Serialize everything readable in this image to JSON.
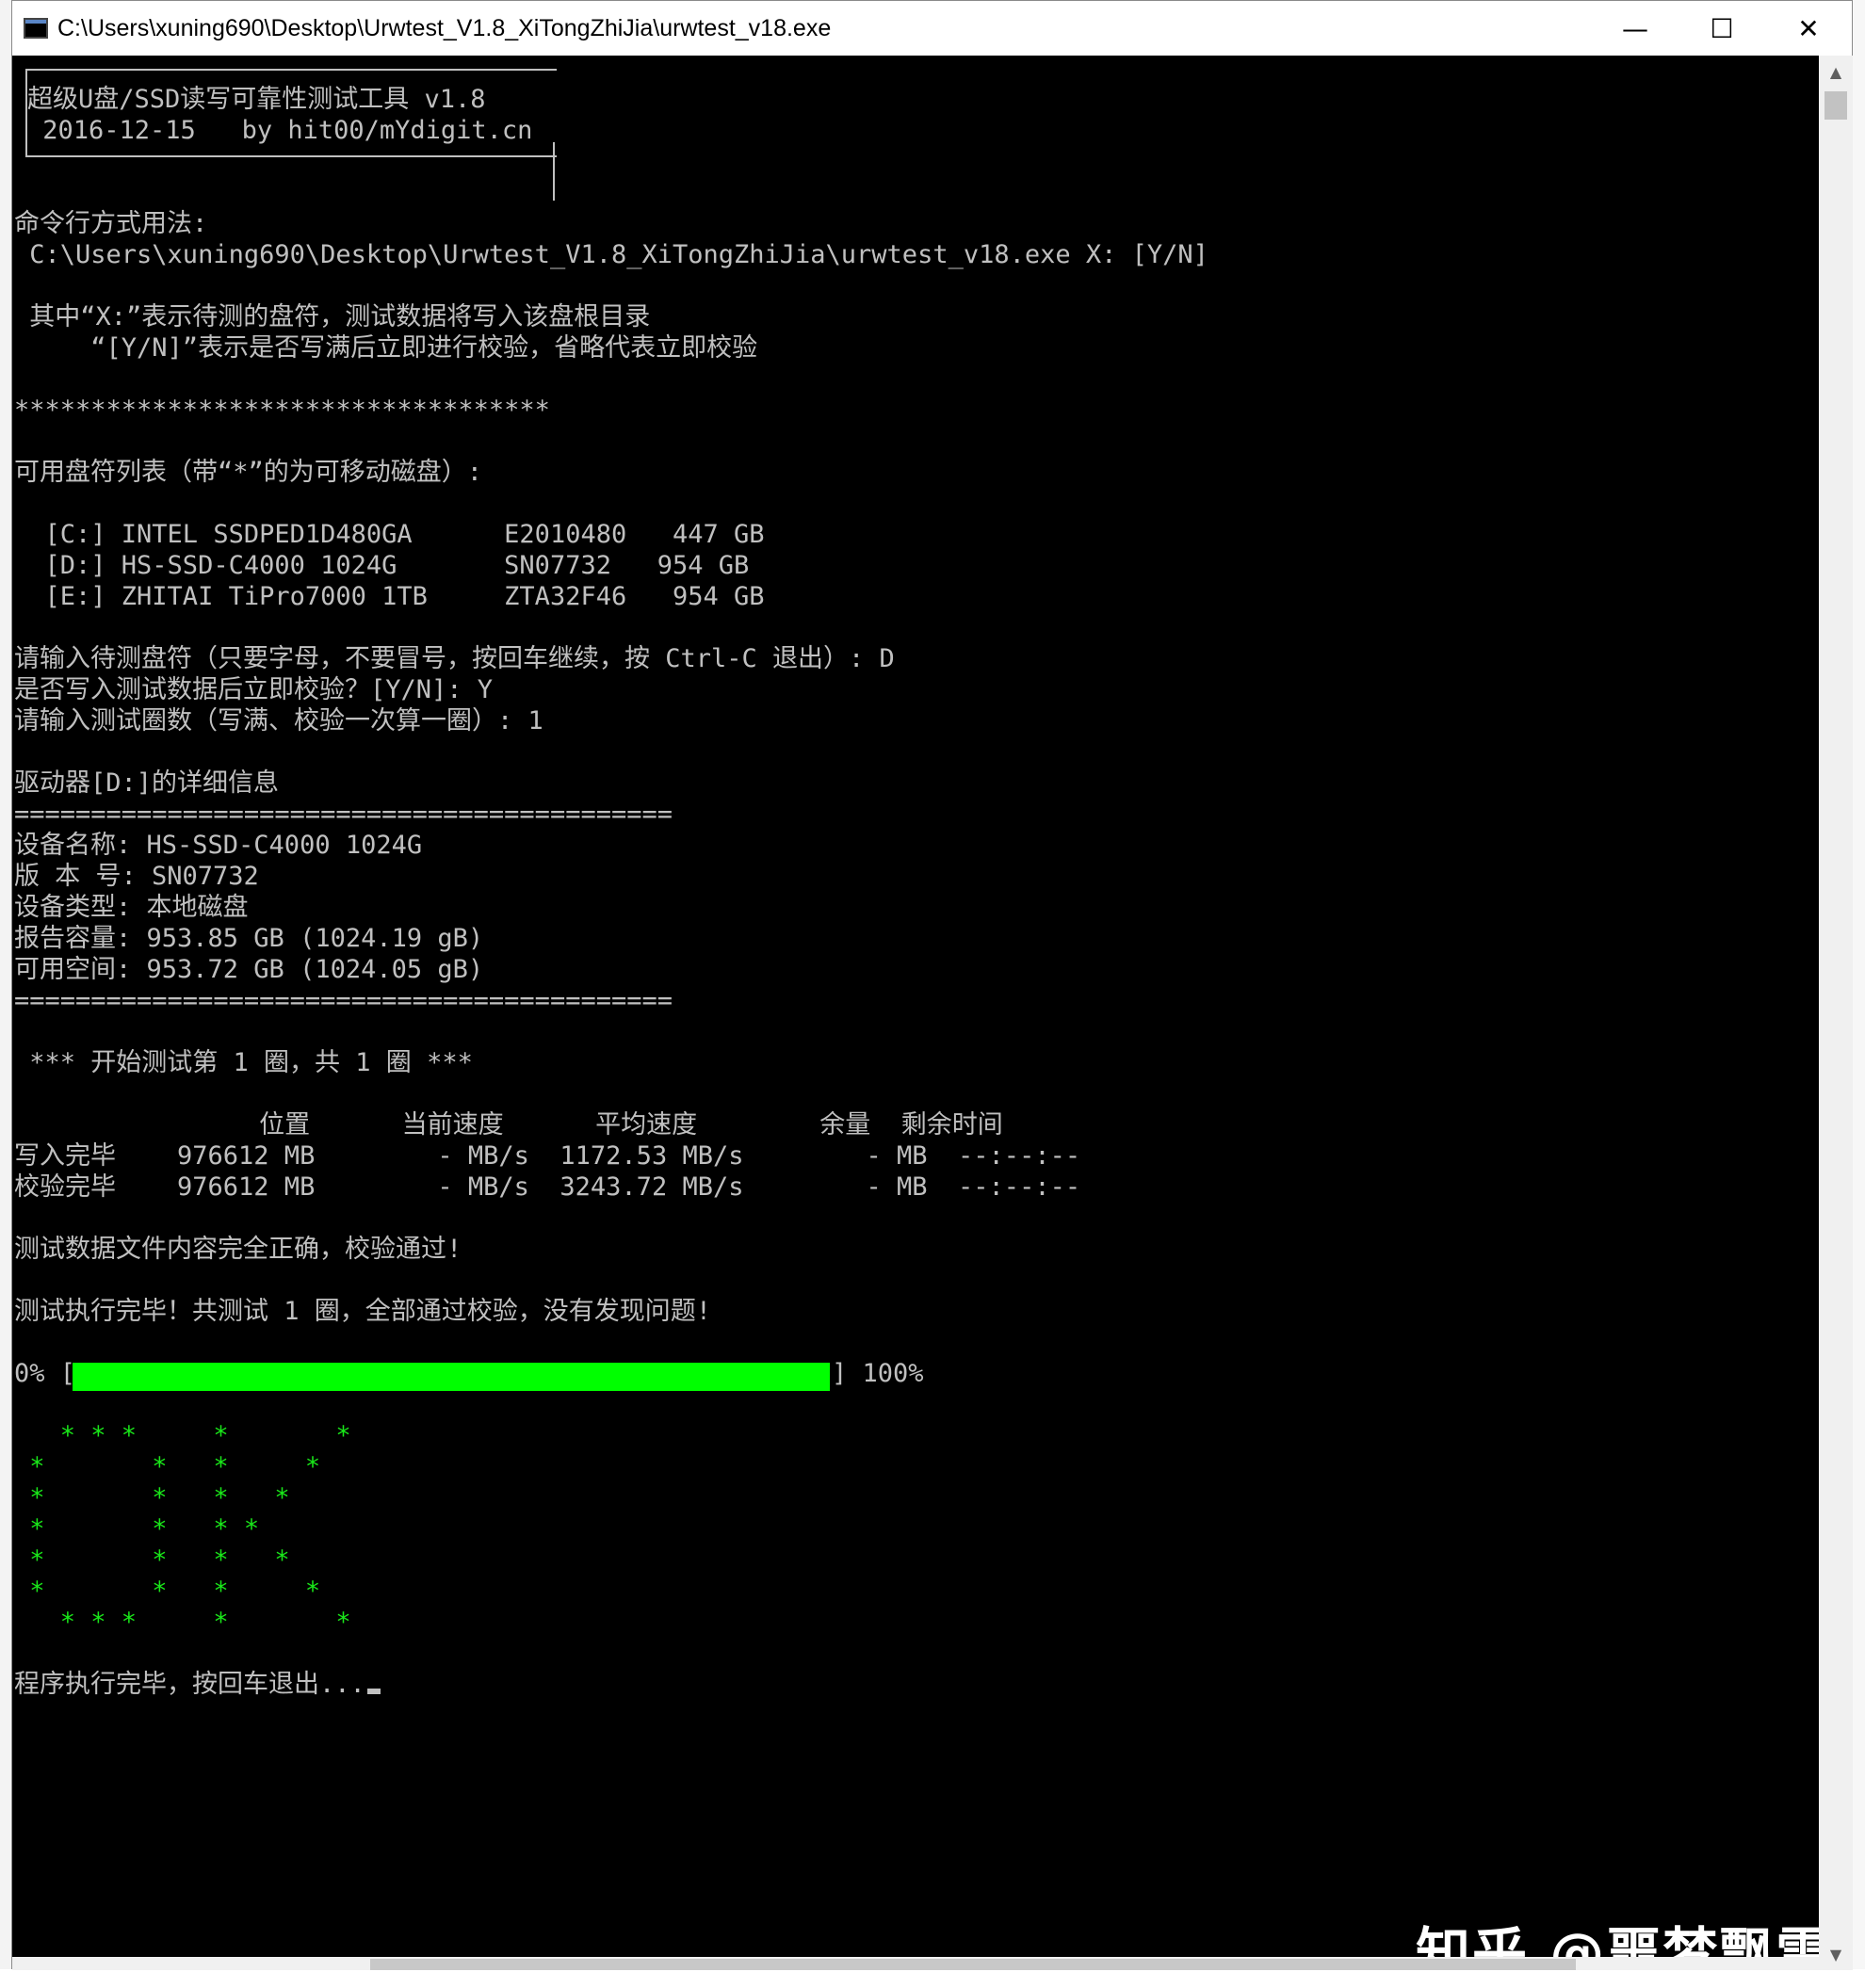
{
  "window": {
    "title": "C:\\Users\\xuning690\\Desktop\\Urwtest_V1.8_XiTongZhiJia\\urwtest_v18.exe",
    "minimize": "—",
    "maximize": "☐",
    "close": "✕"
  },
  "console": {
    "header_line1": "超级U盘/SSD读写可靠性测试工具 v1.8",
    "header_line2": " 2016-12-15   by hit00/mYdigit.cn",
    "usage_title": "命令行方式用法:",
    "usage_cmd": " C:\\Users\\xuning690\\Desktop\\Urwtest_V1.8_XiTongZhiJia\\urwtest_v18.exe X: [Y/N]",
    "usage_desc1": " 其中“X:”表示待测的盘符，测试数据将写入该盘根目录",
    "usage_desc2": "     “[Y/N]”表示是否写满后立即进行校验，省略代表立即校验",
    "separator_stars": "***********************************",
    "drive_list_title": "可用盘符列表（带“*”的为可移动磁盘）:",
    "drives": [
      "  [C:] INTEL SSDPED1D480GA      E2010480   447 GB",
      "  [D:] HS-SSD-C4000 1024G       SN07732   954 GB",
      "  [E:] ZHITAI TiPro7000 1TB     ZTA32F46   954 GB"
    ],
    "prompt_drive": "请输入待测盘符（只要字母，不要冒号，按回车继续，按 Ctrl-C 退出）: D",
    "prompt_verify": "是否写入测试数据后立即校验？[Y/N]: Y",
    "prompt_rounds": "请输入测试圈数（写满、校验一次算一圈）: 1",
    "detail_title": "驱动器[D:]的详细信息",
    "separator_eq": "===========================================",
    "device_name": "设备名称: HS-SSD-C4000 1024G",
    "version": "版 本 号: SN07732",
    "device_type": "设备类型: 本地磁盘",
    "reported_capacity": "报告容量: 953.85 GB (1024.19 gB)",
    "free_space": "可用空间: 953.72 GB (1024.05 gB)",
    "separator_eq2": "===========================================",
    "round_start": " *** 开始测试第 1 圈，共 1 圈 ***",
    "table_header": "                位置      当前速度      平均速度        余量  剩余时间",
    "write_row": "写入完毕    976612 MB        - MB/s  1172.53 MB/s        - MB  --:--:--",
    "verify_row": "校验完毕    976612 MB        - MB/s  3243.72 MB/s        - MB  --:--:--",
    "data_ok": "测试数据文件内容完全正确，校验通过!",
    "all_done": "测试执行完毕！共测试 1 圈，全部通过校验，没有发现问题!",
    "progress_left": "0% [",
    "progress_right": "] 100%",
    "progress_value": 1.0,
    "ok_art": [
      "   * * *     *       *",
      " *       *   *     *",
      " *       *   *   *",
      " *       *   * *",
      " *       *   *   *",
      " *       *   *     *",
      "   * * *     *       *"
    ],
    "exit_msg": "程序执行完毕，按回车退出..."
  },
  "watermark": "知乎 @噩梦飘雷"
}
